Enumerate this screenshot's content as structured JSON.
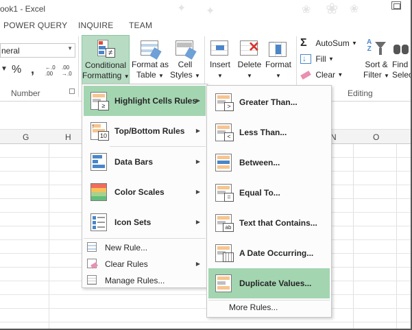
{
  "window": {
    "title": "ook1 - Excel"
  },
  "ribbon_tabs": [
    "POWER QUERY",
    "INQUIRE",
    "TEAM"
  ],
  "ribbon": {
    "number_format_value": "neral",
    "percent_glyph": "%",
    "comma_glyph": ",",
    "inc_decimal": "←.0\n.00",
    "dec_decimal": ".00\n→.0",
    "number_group_label": "Number",
    "editing_group_label": "Editing",
    "conditional_formatting_label_1": "Conditional",
    "conditional_formatting_label_2": "Formatting",
    "format_as_table_label_1": "Format as",
    "format_as_table_label_2": "Table",
    "cell_styles_label_1": "Cell",
    "cell_styles_label_2": "Styles",
    "insert_label": "Insert",
    "delete_label": "Delete",
    "format_label": "Format",
    "autosum_label": "AutoSum",
    "fill_label": "Fill",
    "clear_label": "Clear",
    "sort_filter_label_1": "Sort &",
    "sort_filter_label_2": "Filter",
    "find_select_label_1": "Find",
    "find_select_label_2": "Selec"
  },
  "columns": [
    "G",
    "H",
    "N",
    "O"
  ],
  "cf_menu": {
    "items": [
      {
        "label": "Highlight Cells Rules",
        "has_submenu": true,
        "highlighted": true
      },
      {
        "label": "Top/Bottom Rules",
        "has_submenu": true
      },
      {
        "label": "Data Bars",
        "has_submenu": true
      },
      {
        "label": "Color Scales",
        "has_submenu": true
      },
      {
        "label": "Icon Sets",
        "has_submenu": true
      }
    ],
    "commands": [
      {
        "label": "New Rule...",
        "has_submenu": false
      },
      {
        "label": "Clear Rules",
        "has_submenu": true
      },
      {
        "label": "Manage Rules...",
        "has_submenu": false
      }
    ]
  },
  "highlight_submenu": {
    "items": [
      {
        "label": "Greater Than..."
      },
      {
        "label": "Less Than..."
      },
      {
        "label": "Between..."
      },
      {
        "label": "Equal To..."
      },
      {
        "label": "Text that Contains..."
      },
      {
        "label": "A Date Occurring..."
      },
      {
        "label": "Duplicate Values...",
        "highlighted": true
      }
    ],
    "more_rules": "More Rules..."
  },
  "colors": {
    "menu_highlight": "#a3d5b1",
    "cf_button_active": "#b7dcc3",
    "bar_blue": "#4a86c8",
    "bar_orange": "#f7c58f"
  }
}
